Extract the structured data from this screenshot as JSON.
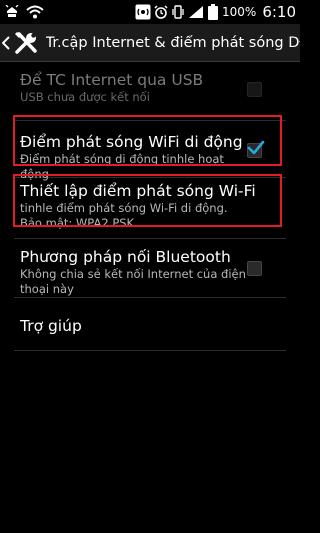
{
  "status_bar": {
    "battery_percent": "100%",
    "time": "6:10",
    "icons": [
      "usb-debug-icon",
      "wifi-icon",
      "hotspot-icon",
      "alarm-icon",
      "vibrate-icon",
      "signal-icon",
      "battery-icon"
    ]
  },
  "action_bar": {
    "title": "Tr.cập Internet & điểm phát sóng DĐ",
    "icons": [
      "back-chevron-icon",
      "tools-icon"
    ]
  },
  "settings": {
    "usb_tethering": {
      "title": "Để TC Internet qua USB",
      "summary": "USB chưa được kết nối",
      "enabled": false,
      "checked": false
    },
    "wifi_hotspot": {
      "title": "Điểm phát sóng WiFi di động",
      "summary": "Điểm phát sóng di động tinhle hoạt động",
      "checked": true
    },
    "hotspot_setup": {
      "title": "Thiết lập điểm phát sóng Wi-Fi",
      "summary_line1": "tinhle điểm phát sóng Wi-Fi di động.",
      "summary_line2": "Bảo mật: WPA2 PSK"
    },
    "bluetooth_tethering": {
      "title": "Phương pháp nối Bluetooth",
      "summary": "Không chia sẻ kết nối Internet của điện thoại này",
      "checked": false
    },
    "help": {
      "title": "Trợ giúp"
    }
  },
  "colors": {
    "highlight": "#e01b2a",
    "check": "#2aa6de",
    "background": "#000000"
  }
}
